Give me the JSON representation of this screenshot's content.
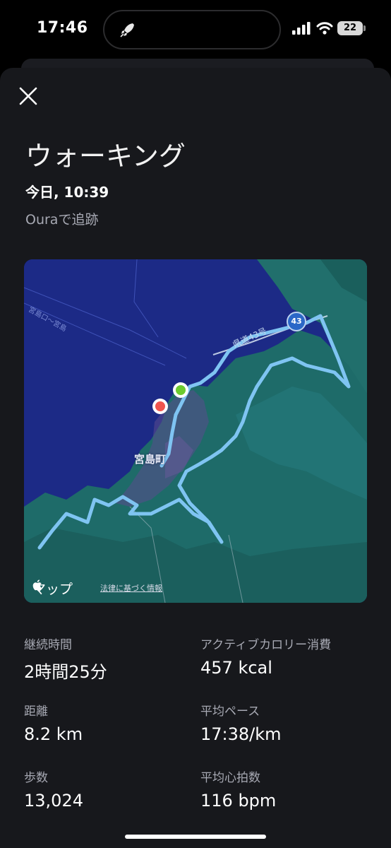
{
  "status_bar": {
    "time": "17:46",
    "battery": "22",
    "activity_icon": "rocket-icon"
  },
  "header": {
    "title": "ウォーキング",
    "datetime": "今日, 10:39",
    "source": "Ouraで追跡"
  },
  "map": {
    "town_label": "宮島町",
    "road_label": "県道43号",
    "route_shield": "43",
    "ferry_label": "宮島口～宮島",
    "logo_text": "マップ",
    "legal_text": "法律に基づく情報",
    "colors": {
      "water": "#1c2a86",
      "land": "#1e6b69",
      "route": "#7fc4f2",
      "start_marker": "#6ccb2f",
      "end_marker": "#f0554e"
    }
  },
  "stats": [
    {
      "label": "継続時間",
      "value": "2時間25分"
    },
    {
      "label": "アクティブカロリー消費",
      "value": "457 kcal"
    },
    {
      "label": "距離",
      "value": "8.2 km"
    },
    {
      "label": "平均ペース",
      "value": "17:38/km"
    },
    {
      "label": "歩数",
      "value": "13,024"
    },
    {
      "label": "平均心拍数",
      "value": "116 bpm"
    }
  ]
}
